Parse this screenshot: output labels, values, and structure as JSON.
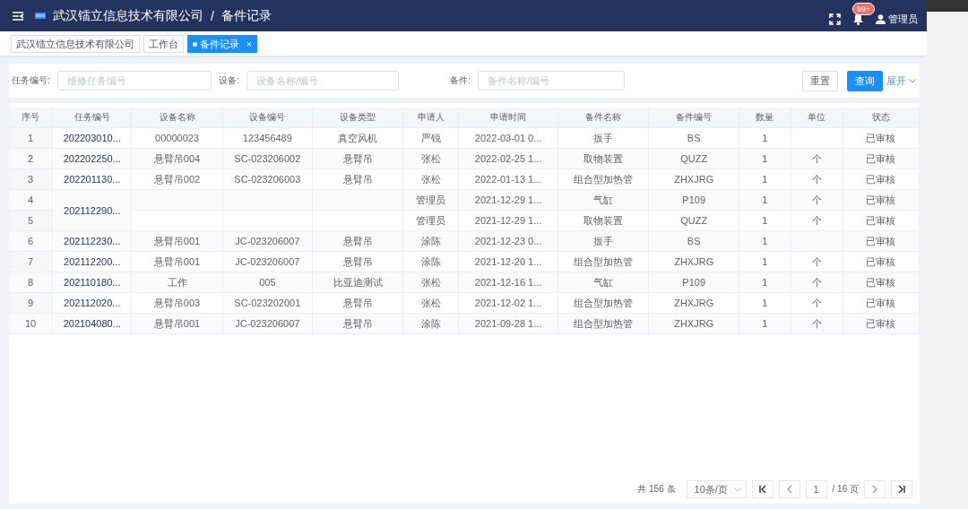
{
  "header": {
    "company": "武汉镭立信息技术有限公司",
    "separator": "/",
    "page_title": "备件记录",
    "notification_badge": "99+",
    "user": "管理员"
  },
  "tabs": [
    {
      "label": "武汉镭立信息技术有限公司",
      "selected": false,
      "closable": false
    },
    {
      "label": "工作台",
      "selected": false,
      "closable": false
    },
    {
      "label": "备件记录",
      "selected": true,
      "closable": true,
      "close": "×"
    }
  ],
  "filters": [
    {
      "label": "任务编号:",
      "placeholder": "维修任务编号"
    },
    {
      "label": "设备:",
      "placeholder": "设备名称/编号"
    },
    {
      "label": "备件:",
      "placeholder": "备件名称/编号"
    }
  ],
  "buttons": {
    "reset": "重置",
    "search": "查询",
    "expand": "展开"
  },
  "table": {
    "columns": [
      "序号",
      "任务编号",
      "设备名称",
      "设备编号",
      "设备类型",
      "申请人",
      "申请时间",
      "备件名称",
      "备件编号",
      "数量",
      "单位",
      "状态"
    ],
    "rows": [
      {
        "cells": [
          "1",
          "202203010...",
          "00000023",
          "123456489",
          "真空风机",
          "严锐",
          "2022-03-01 0...",
          "扳手",
          "BS",
          "1",
          "",
          "已审核"
        ]
      },
      {
        "cells": [
          "2",
          "202202250...",
          "悬臂吊004",
          "SC-023206002",
          "悬臂吊",
          "张松",
          "2022-02-25 1...",
          "取物装置",
          "QUZZ",
          "1",
          "个",
          "已审核"
        ]
      },
      {
        "cells": [
          "3",
          "202201130...",
          "悬臂吊002",
          "SC-023206003",
          "悬臂吊",
          "张松",
          "2022-01-13 1...",
          "组合型加热管",
          "ZHXJRG",
          "1",
          "个",
          "已审核"
        ]
      },
      {
        "cells": [
          "4",
          {
            "text": "202112290...",
            "rowspan": 2
          },
          "",
          "",
          "",
          "管理员",
          "2021-12-29 1...",
          "气缸",
          "P109",
          "1",
          "个",
          "已审核"
        ]
      },
      {
        "cells": [
          "5",
          "",
          "",
          "",
          "管理员",
          "2021-12-29 1...",
          "取物装置",
          "QUZZ",
          "1",
          "个",
          "已审核"
        ]
      },
      {
        "cells": [
          "6",
          "202112230...",
          "悬臂吊001",
          "JC-023206007",
          "悬臂吊",
          "涂陈",
          "2021-12-23 0...",
          "扳手",
          "BS",
          "1",
          "",
          "已审核"
        ]
      },
      {
        "cells": [
          "7",
          "202112200...",
          "悬臂吊001",
          "JC-023206007",
          "悬臂吊",
          "涂陈",
          "2021-12-20 1...",
          "组合型加热管",
          "ZHXJRG",
          "1",
          "个",
          "已审核"
        ]
      },
      {
        "cells": [
          "8",
          "202110180...",
          "工作",
          "005",
          "比亚迪测试",
          "张松",
          "2021-12-16 1...",
          "气缸",
          "P109",
          "1",
          "个",
          "已审核"
        ]
      },
      {
        "cells": [
          "9",
          "202112020...",
          "悬臂吊003",
          "SC-023202001",
          "悬臂吊",
          "张松",
          "2021-12-02 1...",
          "组合型加热管",
          "ZHXJRG",
          "1",
          "个",
          "已审核"
        ]
      },
      {
        "cells": [
          "10",
          "202104080...",
          "悬臂吊001",
          "JC-023206007",
          "悬臂吊",
          "涂陈",
          "2021-09-28 1...",
          "组合型加热管",
          "ZHXJRG",
          "1",
          "个",
          "已审核"
        ]
      }
    ]
  },
  "pagination": {
    "total": "共 156 条",
    "page_size": "10条/页",
    "page": "1",
    "page_count": "/ 16 页"
  }
}
